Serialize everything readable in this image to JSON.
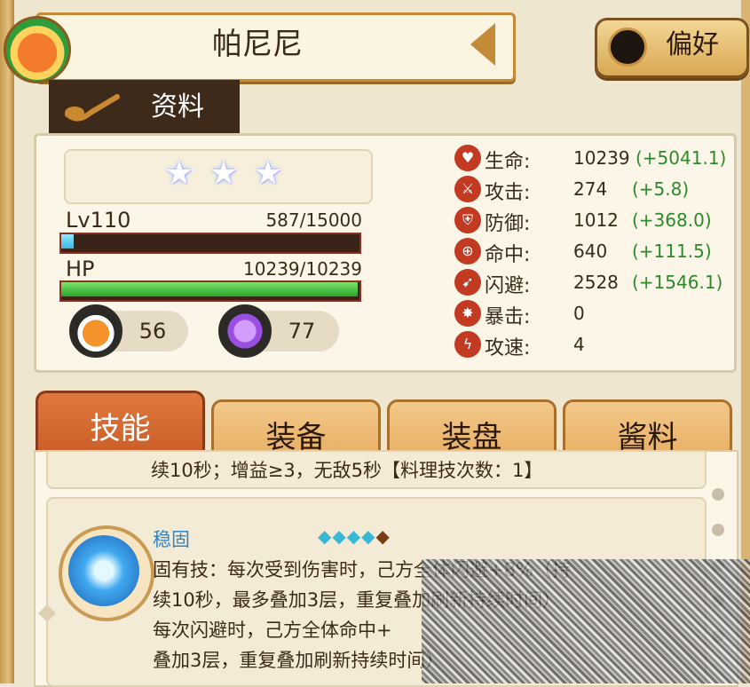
{
  "header": {
    "title": "帕尼尼",
    "preference_label": "偏好",
    "info_tab": "资料"
  },
  "character": {
    "stars": [
      "★",
      "★",
      "★"
    ],
    "level_label": "Lv110",
    "exp": "587/15000",
    "exp_fraction": 0.039,
    "hp_label": "HP",
    "hp": "10239/10239",
    "hp_fraction": 1.0,
    "resource1": "56",
    "resource2": "77"
  },
  "stats": [
    {
      "name": "生命:",
      "value": "10239",
      "bonus": "(+5041.1)",
      "icon": "heart-icon"
    },
    {
      "name": "攻击:",
      "value": "274",
      "bonus": "(+5.8)",
      "icon": "sword-icon"
    },
    {
      "name": "防御:",
      "value": "1012",
      "bonus": "(+368.0)",
      "icon": "shield-icon"
    },
    {
      "name": "命中:",
      "value": "640",
      "bonus": "(+111.5)",
      "icon": "target-icon"
    },
    {
      "name": "闪避:",
      "value": "2528",
      "bonus": "(+1546.1)",
      "icon": "dodge-icon"
    },
    {
      "name": "暴击:",
      "value": "0",
      "bonus": "",
      "icon": "critical-icon"
    },
    {
      "name": "攻速:",
      "value": "4",
      "bonus": "",
      "icon": "lightning-icon"
    }
  ],
  "tabs": [
    "技能",
    "装备",
    "装盘",
    "酱料"
  ],
  "skills": {
    "previous_text": "续10秒；增益≥3，无敌5秒【料理技次数：1】",
    "current": {
      "name": "稳固",
      "diamonds": "◆◆◆◆",
      "diamond_dark": "◆",
      "lines": [
        "固有技：每次受到伤害时，己方全体闪避+8%（持",
        "续10秒，最多叠加3层，重复叠加刷新持续时间）",
        "每次闪避时，己方全体命中+",
        "叠加3层，重复叠加刷新持续时间）"
      ]
    }
  },
  "colors": {
    "accent": "#c75a25",
    "bonus_green": "#2c8a2a",
    "stat_icon": "#c23a22"
  }
}
